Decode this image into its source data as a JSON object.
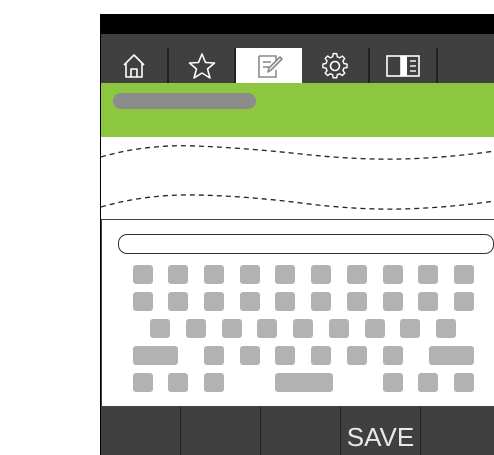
{
  "app": {
    "tabs": [
      {
        "name": "home",
        "icon": "home-icon"
      },
      {
        "name": "favorites",
        "icon": "star-icon"
      },
      {
        "name": "edit",
        "icon": "edit-icon",
        "active": true
      },
      {
        "name": "settings",
        "icon": "gear-icon"
      },
      {
        "name": "reader",
        "icon": "book-icon"
      }
    ],
    "colors": {
      "header_black": "#000000",
      "toolbar_gray": "#404040",
      "accent_green": "#8dc63f",
      "key_gray": "#b2b2b2"
    }
  },
  "bottom_bar": {
    "buttons": [
      "",
      "",
      "",
      "SAVE",
      ""
    ]
  }
}
